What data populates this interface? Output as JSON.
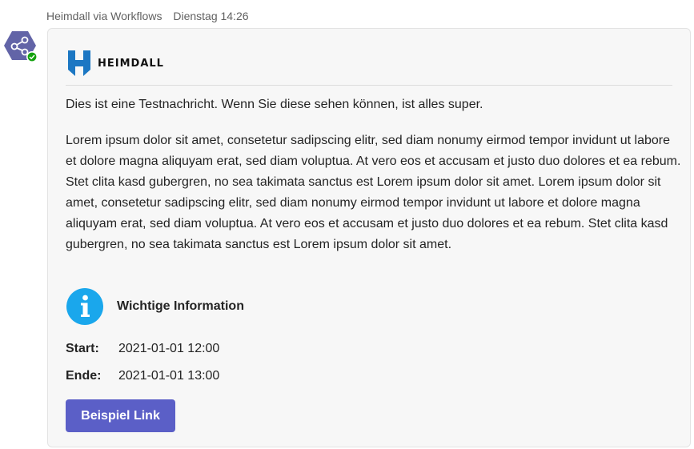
{
  "message": {
    "sender": "Heimdall via Workflows",
    "timestamp": "Dienstag 14:26"
  },
  "card": {
    "logo_text": "HEIMDALL",
    "intro": "Dies ist eine Testnachricht. Wenn Sie diese sehen können, ist alles super.",
    "body": "Lorem ipsum dolor sit amet, consetetur sadipscing elitr, sed diam nonumy eirmod tempor invidunt ut labore et dolore magna aliquyam erat, sed diam voluptua. At vero eos et accusam et justo duo dolores et ea rebum. Stet clita kasd gubergren, no sea takimata sanctus est Lorem ipsum dolor sit amet. Lorem ipsum dolor sit amet, consetetur sadipscing elitr, sed diam nonumy eirmod tempor invidunt ut labore et dolore magna aliquyam erat, sed diam voluptua. At vero eos et accusam et justo duo dolores et ea rebum. Stet clita kasd gubergren, no sea takimata sanctus est Lorem ipsum dolor sit amet.",
    "info_title": "Wichtige Information",
    "facts": [
      {
        "label": "Start:",
        "value": "2021-01-01 12:00"
      },
      {
        "label": "Ende:",
        "value": "2021-01-01 13:00"
      }
    ],
    "button_label": "Beispiel Link"
  },
  "icons": {
    "avatar": "workflows-share-icon",
    "status": "available-check-icon",
    "info": "info-icon",
    "logo": "heimdall-logo-icon"
  },
  "colors": {
    "accent": "#5b5fc7",
    "avatar_bg": "#6264a7",
    "status": "#13a10e",
    "info_bg": "#1aa7ec",
    "logo_blue": "#1c77c3"
  }
}
